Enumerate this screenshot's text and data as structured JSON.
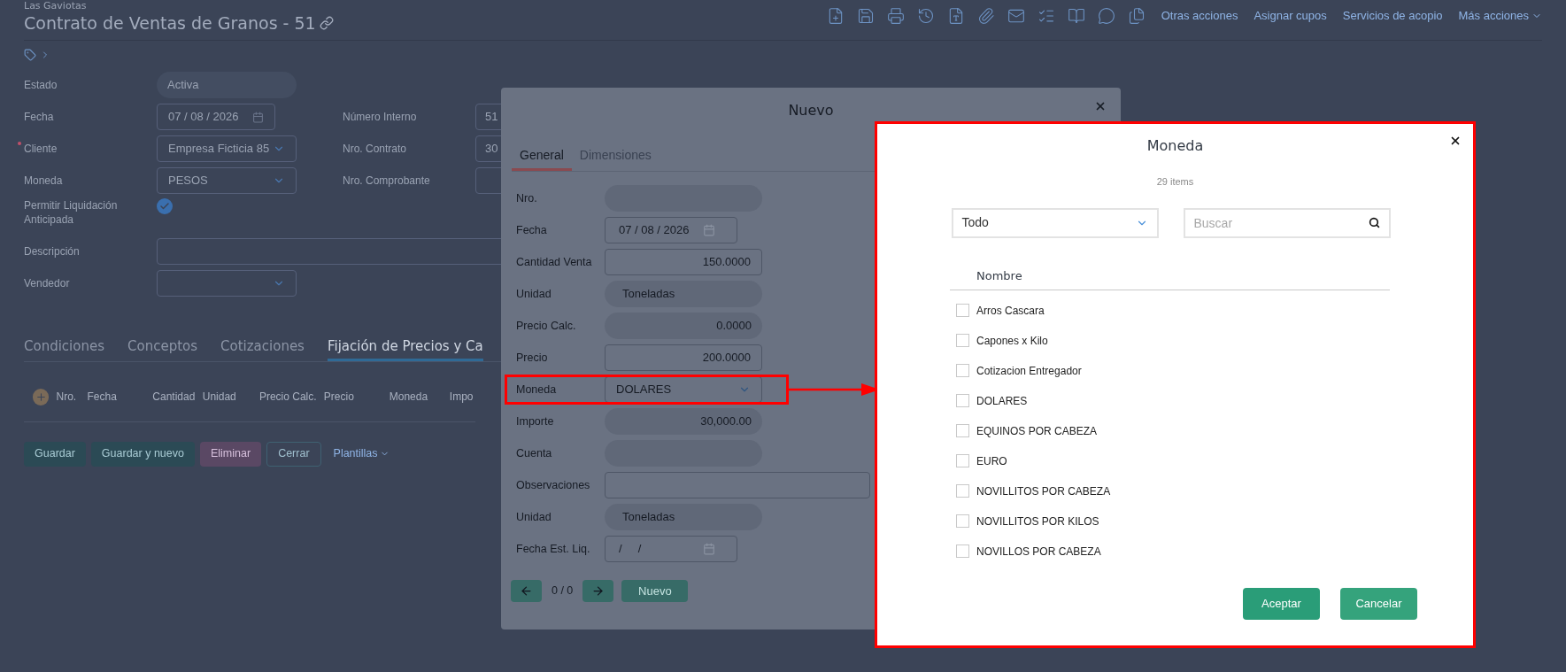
{
  "header": {
    "company": "Las Gaviotas",
    "title": "Contrato de Ventas de Granos - 51"
  },
  "toolbar": {
    "actions": [
      "Otras acciones",
      "Asignar cupos",
      "Servicios de acopio"
    ],
    "more": "Más acciones"
  },
  "form": {
    "left": [
      {
        "label": "Estado",
        "value": "Activa",
        "kind": "readonly",
        "required": false
      },
      {
        "label": "Fecha",
        "value": "07 / 08 / 2026",
        "kind": "date",
        "required": false
      },
      {
        "label": "Cliente",
        "value": "Empresa Ficticia 85",
        "kind": "select",
        "required": true
      },
      {
        "label": "Moneda",
        "value": "PESOS",
        "kind": "select",
        "required": false
      },
      {
        "label": "Permitir Liquidación Anticipada",
        "kind": "checkbox",
        "checked": true,
        "required": false
      },
      {
        "label": "Descripción",
        "kind": "wide",
        "required": false
      },
      {
        "label": "Vendedor",
        "kind": "select",
        "required": false
      }
    ],
    "right": [
      {
        "label": "Número Interno",
        "value": "51"
      },
      {
        "label": "Nro. Contrato",
        "value": "30"
      },
      {
        "label": "Nro. Comprobante"
      }
    ]
  },
  "tabs": [
    {
      "label": "Condiciones",
      "selected": false
    },
    {
      "label": "Conceptos",
      "selected": false
    },
    {
      "label": "Cotizaciones",
      "selected": false
    },
    {
      "label": "Fijación de Precios y Ca",
      "selected": true
    }
  ],
  "table": {
    "columns": [
      "Nro.",
      "Fecha",
      "Cantidad",
      "Unidad",
      "Precio Calc.",
      "Precio",
      "Moneda",
      "Impo"
    ]
  },
  "buttons": [
    {
      "label": "Guardar",
      "kind": "save"
    },
    {
      "label": "Guardar y nuevo",
      "kind": "save"
    },
    {
      "label": "Eliminar",
      "kind": "danger"
    },
    {
      "label": "Cerrar",
      "kind": "outline"
    },
    {
      "label": "Plantillas",
      "kind": "link"
    }
  ],
  "modal": {
    "title": "Nuevo",
    "tabs": [
      {
        "label": "General",
        "selected": true
      },
      {
        "label": "Dimensiones",
        "selected": false
      }
    ],
    "fields": [
      {
        "label": "Nro.",
        "kind": "readonly",
        "highlighted": false
      },
      {
        "label": "Fecha",
        "value": "07 / 08 / 2026",
        "kind": "date",
        "highlighted": false
      },
      {
        "label": "Cantidad Venta",
        "value": "150.0000",
        "kind": "number",
        "highlighted": false
      },
      {
        "label": "Unidad",
        "value": "Toneladas",
        "kind": "readonly",
        "highlighted": false
      },
      {
        "label": "Precio Calc.",
        "value": "0.0000",
        "kind": "readonly-number",
        "highlighted": false
      },
      {
        "label": "Precio",
        "value": "200.0000",
        "kind": "number",
        "highlighted": false
      },
      {
        "label": "Moneda",
        "value": "DOLARES",
        "kind": "select",
        "highlighted": true
      },
      {
        "label": "Importe",
        "value": "30,000.00",
        "kind": "readonly-number",
        "highlighted": false
      },
      {
        "label": "Cuenta",
        "kind": "readonly",
        "highlighted": false
      },
      {
        "label": "Observaciones",
        "kind": "wide",
        "highlighted": false
      },
      {
        "label": "Unidad",
        "value": "Toneladas",
        "kind": "readonly",
        "highlighted": false
      },
      {
        "label": "Fecha Est. Liq.",
        "value": "/     /",
        "kind": "date",
        "highlighted": false
      }
    ],
    "pager": "0 / 0",
    "new_button": "Nuevo"
  },
  "dialog": {
    "title": "Moneda",
    "count": "29 items",
    "filter": "Todo",
    "search": {
      "placeholder": "Buscar"
    },
    "column": "Nombre",
    "items": [
      {
        "name": "Arros Cascara",
        "checked": false
      },
      {
        "name": "Capones x Kilo",
        "checked": false
      },
      {
        "name": "Cotizacion Entregador",
        "checked": false
      },
      {
        "name": "DOLARES",
        "checked": false
      },
      {
        "name": "EQUINOS POR CABEZA",
        "checked": false
      },
      {
        "name": "EURO",
        "checked": false
      },
      {
        "name": "NOVILLITOS POR CABEZA",
        "checked": false
      },
      {
        "name": "NOVILLITOS POR KILOS",
        "checked": false
      },
      {
        "name": "NOVILLOS POR CABEZA",
        "checked": false
      }
    ],
    "buttons": [
      {
        "label": "Aceptar",
        "kind": "primary"
      },
      {
        "label": "Cancelar",
        "kind": "secondary"
      }
    ]
  }
}
